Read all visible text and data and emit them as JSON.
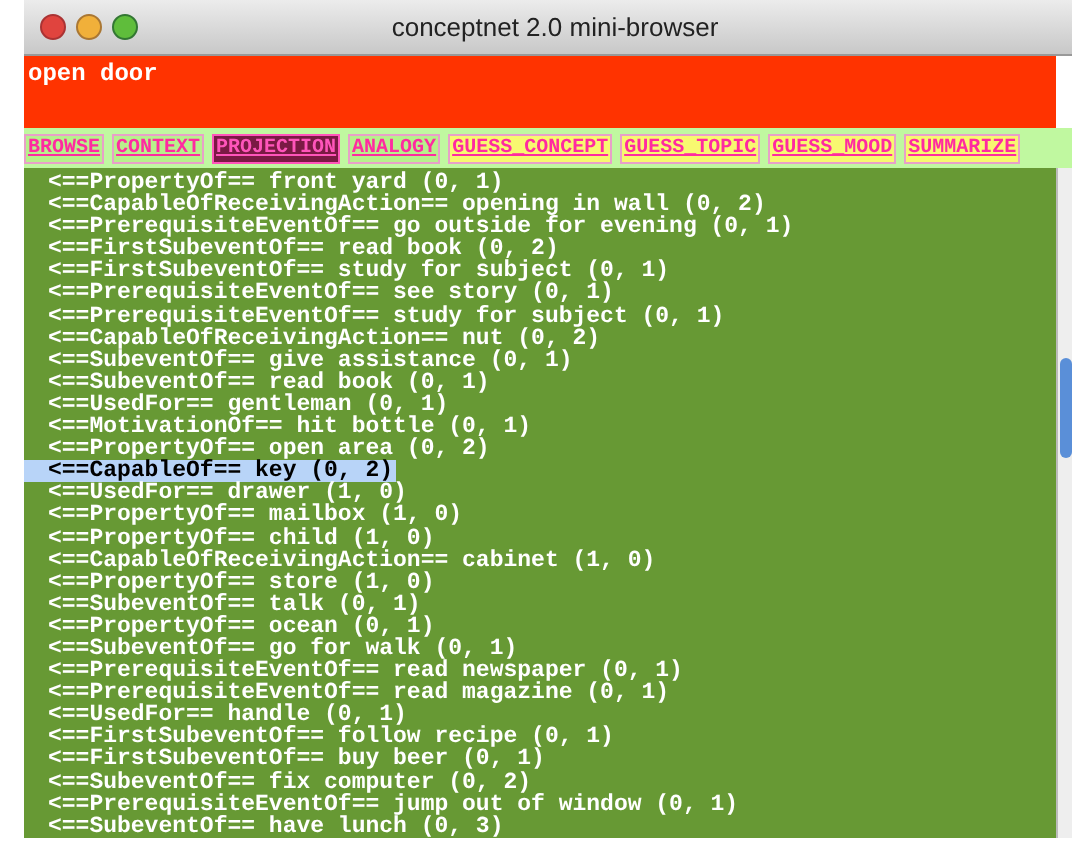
{
  "window": {
    "title": "conceptnet 2.0 mini-browser"
  },
  "query": {
    "value": "open door"
  },
  "tabs": [
    {
      "label": "BROWSE",
      "selected": false,
      "color": "#b8f08c"
    },
    {
      "label": "CONTEXT",
      "selected": false,
      "color": "#b8f08c"
    },
    {
      "label": "PROJECTION",
      "selected": true,
      "color": "#7a1a44"
    },
    {
      "label": "ANALOGY",
      "selected": false,
      "color": "#b8f08c"
    },
    {
      "label": "GUESS_CONCEPT",
      "selected": false,
      "color": "#f8f870"
    },
    {
      "label": "GUESS_TOPIC",
      "selected": false,
      "color": "#f8f870"
    },
    {
      "label": "GUESS_MOOD",
      "selected": false,
      "color": "#f8f870"
    },
    {
      "label": "SUMMARIZE",
      "selected": false,
      "color": "#f8f870"
    }
  ],
  "results": [
    {
      "text": "<==PropertyOf== front yard (0, 1)",
      "selected": false
    },
    {
      "text": "<==CapableOfReceivingAction== opening in wall (0, 2)",
      "selected": false
    },
    {
      "text": "<==PrerequisiteEventOf== go outside for evening (0, 1)",
      "selected": false
    },
    {
      "text": "<==FirstSubeventOf== read book (0, 2)",
      "selected": false
    },
    {
      "text": "<==FirstSubeventOf== study for subject (0, 1)",
      "selected": false
    },
    {
      "text": "<==PrerequisiteEventOf== see story (0, 1)",
      "selected": false
    },
    {
      "text": "<==PrerequisiteEventOf== study for subject (0, 1)",
      "selected": false
    },
    {
      "text": "<==CapableOfReceivingAction== nut (0, 2)",
      "selected": false
    },
    {
      "text": "<==SubeventOf== give assistance (0, 1)",
      "selected": false
    },
    {
      "text": "<==SubeventOf== read book (0, 1)",
      "selected": false
    },
    {
      "text": "<==UsedFor== gentleman (0, 1)",
      "selected": false
    },
    {
      "text": "<==MotivationOf== hit bottle (0, 1)",
      "selected": false
    },
    {
      "text": "<==PropertyOf== open area (0, 2)",
      "selected": false
    },
    {
      "text": "<==CapableOf== key (0, 2)",
      "selected": true
    },
    {
      "text": "<==UsedFor== drawer (1, 0)",
      "selected": false
    },
    {
      "text": "<==PropertyOf== mailbox (1, 0)",
      "selected": false
    },
    {
      "text": "<==PropertyOf== child (1, 0)",
      "selected": false
    },
    {
      "text": "<==CapableOfReceivingAction== cabinet (1, 0)",
      "selected": false
    },
    {
      "text": "<==PropertyOf== store (1, 0)",
      "selected": false
    },
    {
      "text": "<==SubeventOf== talk (0, 1)",
      "selected": false
    },
    {
      "text": "<==PropertyOf== ocean (0, 1)",
      "selected": false
    },
    {
      "text": "<==SubeventOf== go for walk (0, 1)",
      "selected": false
    },
    {
      "text": "<==PrerequisiteEventOf== read newspaper (0, 1)",
      "selected": false
    },
    {
      "text": "<==PrerequisiteEventOf== read magazine (0, 1)",
      "selected": false
    },
    {
      "text": "<==UsedFor== handle (0, 1)",
      "selected": false
    },
    {
      "text": "<==FirstSubeventOf== follow recipe (0, 1)",
      "selected": false
    },
    {
      "text": "<==FirstSubeventOf== buy beer (0, 1)",
      "selected": false
    },
    {
      "text": "<==SubeventOf== fix computer (0, 2)",
      "selected": false
    },
    {
      "text": "<==PrerequisiteEventOf== jump out of window (0, 1)",
      "selected": false
    },
    {
      "text": "<==SubeventOf== have lunch (0, 3)",
      "selected": false
    }
  ]
}
